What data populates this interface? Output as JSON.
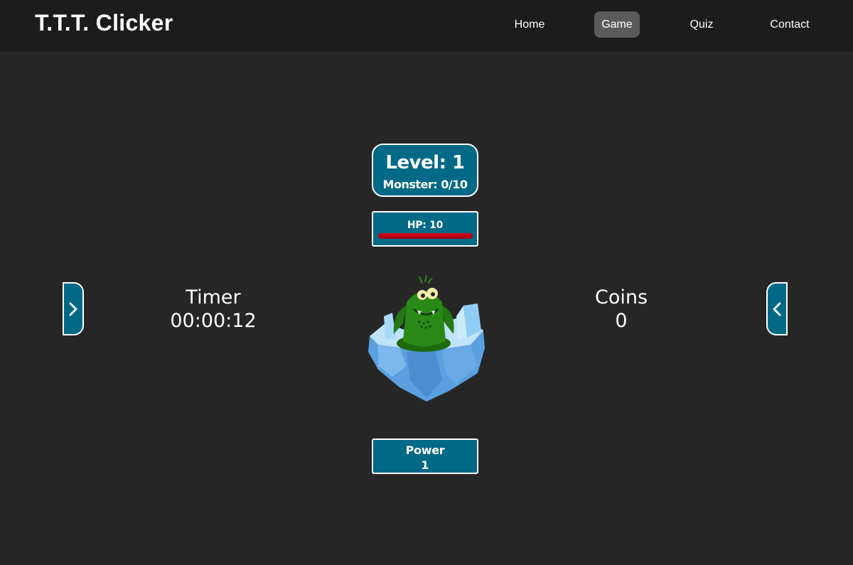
{
  "header": {
    "brand": "T.T.T. Clicker",
    "nav": [
      {
        "label": "Home",
        "active": false
      },
      {
        "label": "Game",
        "active": true
      },
      {
        "label": "Quiz",
        "active": false
      },
      {
        "label": "Contact",
        "active": false
      }
    ]
  },
  "game": {
    "level_label": "Level: 1",
    "monster_progress": "Monster: 0/10",
    "hp_label": "HP: 10",
    "hp_fraction": 1.0,
    "timer_label": "Timer",
    "timer_value": "00:00:12",
    "coins_label": "Coins",
    "coins_value": "0",
    "power_label": "Power",
    "power_value": "1",
    "left_button_icon": "chevron-right-icon",
    "right_button_icon": "chevron-left-icon",
    "monster_icon": "green-monster-on-ice-island"
  },
  "colors": {
    "background": "#262626",
    "navbar": "#1c1c1c",
    "panel": "#006986",
    "hp_bar": "#d5001a"
  }
}
